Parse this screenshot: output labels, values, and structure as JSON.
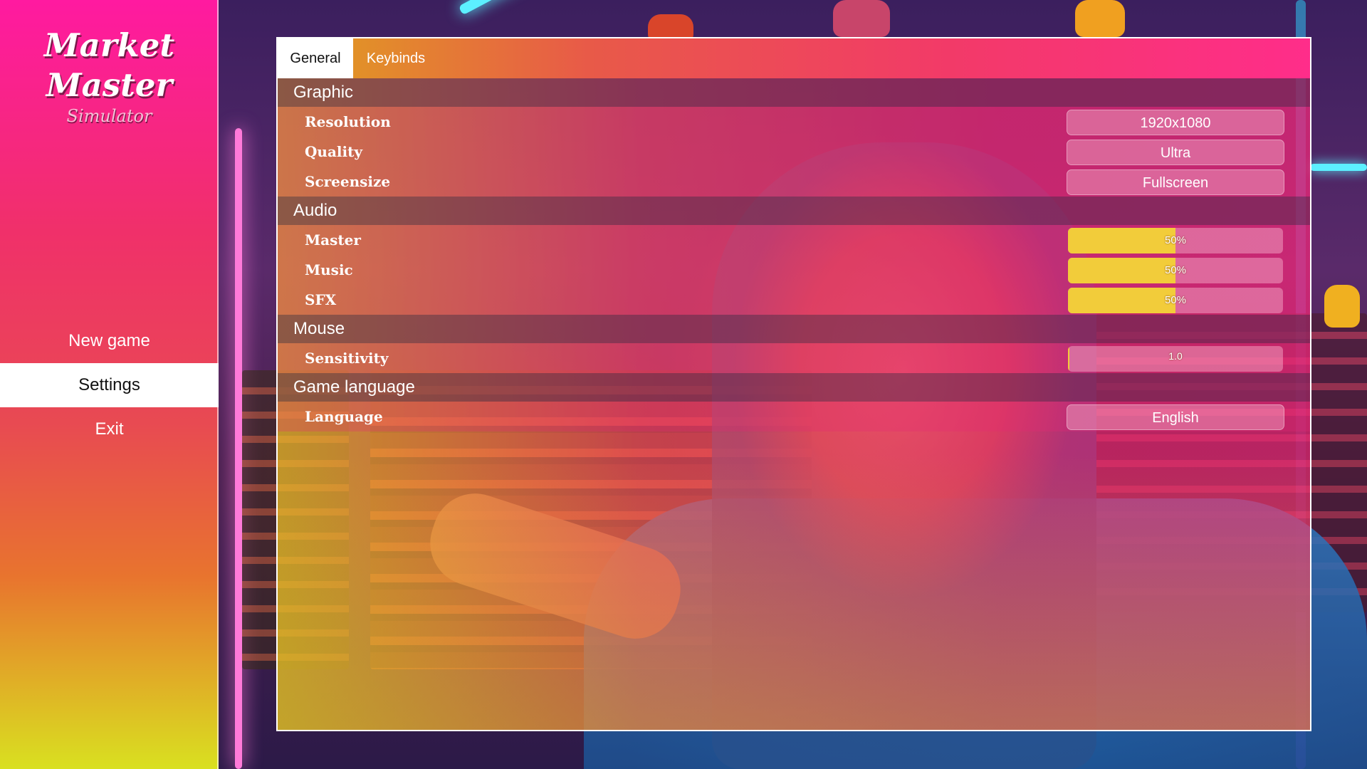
{
  "app": {
    "title": "Market Master",
    "subtitle": "Simulator"
  },
  "menu": {
    "items": [
      {
        "label": "New game",
        "active": false
      },
      {
        "label": "Settings",
        "active": true
      },
      {
        "label": "Exit",
        "active": false
      }
    ]
  },
  "tabs": [
    {
      "label": "General",
      "active": true
    },
    {
      "label": "Keybinds",
      "active": false
    }
  ],
  "sections": {
    "graphic": {
      "title": "Graphic",
      "resolution": {
        "label": "Resolution",
        "value": "1920x1080"
      },
      "quality": {
        "label": "Quality",
        "value": "Ultra"
      },
      "screensize": {
        "label": "Screensize",
        "value": "Fullscreen"
      }
    },
    "audio": {
      "title": "Audio",
      "master": {
        "label": "Master",
        "value": "50%",
        "level": 0.5
      },
      "music": {
        "label": "Music",
        "value": "50%",
        "level": 0.5
      },
      "sfx": {
        "label": "SFX",
        "value": "50%",
        "level": 0.5
      }
    },
    "mouse": {
      "title": "Mouse",
      "sensitivity": {
        "label": "Sensitivity",
        "value": "1.0",
        "level": 0.005
      }
    },
    "language": {
      "title": "Game language",
      "language": {
        "label": "Language",
        "value": "English"
      }
    }
  },
  "colors": {
    "accent_fill": "#f2cc3a",
    "sidebar_top": "#ff1aa0",
    "sidebar_bottom": "#d9e020"
  }
}
